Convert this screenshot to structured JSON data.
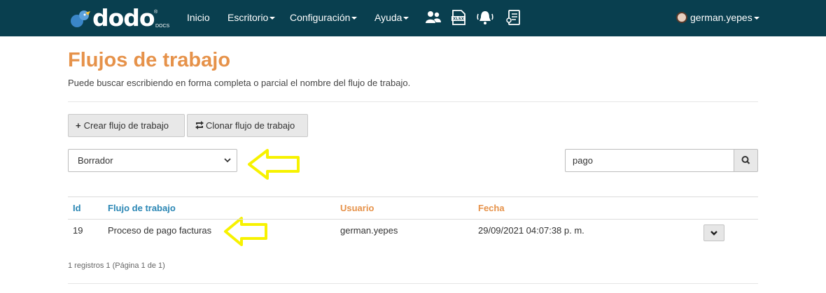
{
  "brand": {
    "name": "dodo",
    "sub": "DOCS",
    "reg": "®"
  },
  "nav": {
    "inicio": "Inicio",
    "escritorio": "Escritorio",
    "configuracion": "Configuración",
    "ayuda": "Ayuda",
    "user": "german.yepes"
  },
  "icons": [
    "users-icon",
    "xlsx-icon",
    "bell-icon",
    "report-icon",
    "search-icon",
    "chevron-down-icon",
    "plus-icon",
    "clone-icon"
  ],
  "page": {
    "title": "Flujos de trabajo",
    "subtitle": "Puede buscar escribiendo en forma completa o parcial el nombre del flujo de trabajo."
  },
  "toolbar": {
    "create_label": "Crear flujo de trabajo",
    "clone_label": "Clonar flujo de trabajo"
  },
  "filter": {
    "selected": "Borrador"
  },
  "search": {
    "value": "pago"
  },
  "table": {
    "headers": {
      "id": "Id",
      "flujo": "Flujo de trabajo",
      "usuario": "Usuario",
      "fecha": "Fecha"
    },
    "rows": [
      {
        "id": "19",
        "flujo": "Proceso de pago facturas",
        "usuario": "german.yepes",
        "fecha": "29/09/2021 04:07:38 p. m."
      }
    ]
  },
  "pagination": {
    "info": "1 registros 1 (Página 1 de 1)"
  },
  "colors": {
    "navbar": "#093f4f",
    "title": "#e6924a",
    "link_header": "#2a86b4",
    "annotation_arrow": "#ffff00"
  }
}
